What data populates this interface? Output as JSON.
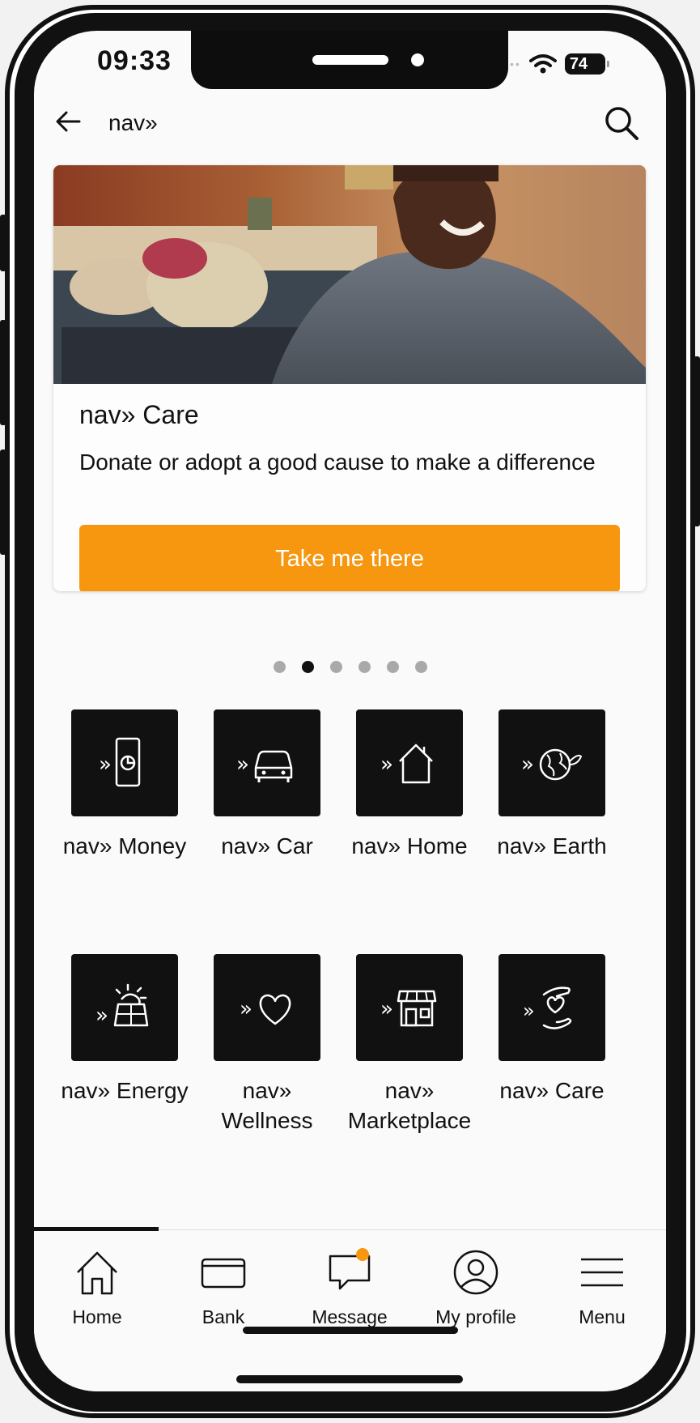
{
  "status_bar": {
    "time": "09:33",
    "battery": "74"
  },
  "header": {
    "title": "nav»"
  },
  "card": {
    "title": "nav» Care",
    "description": "Donate or adopt a good cause to make a difference",
    "button_label": "Take me there"
  },
  "pager": {
    "count": 6,
    "active_index": 1
  },
  "tiles": [
    {
      "label": "nav» Money",
      "icon": "money-phone-icon"
    },
    {
      "label": "nav» Car",
      "icon": "car-icon"
    },
    {
      "label": "nav» Home",
      "icon": "house-icon"
    },
    {
      "label": "nav» Earth",
      "icon": "globe-leaf-icon"
    },
    {
      "label": "nav» Energy",
      "icon": "solar-panel-icon"
    },
    {
      "label": "nav» Wellness",
      "icon": "heart-icon"
    },
    {
      "label": "nav» Marketplace",
      "icon": "storefront-icon"
    },
    {
      "label": "nav» Care",
      "icon": "hands-heart-icon"
    }
  ],
  "tabbar": {
    "items": [
      {
        "label": "Home",
        "icon": "home-icon"
      },
      {
        "label": "Bank",
        "icon": "card-icon"
      },
      {
        "label": "Message",
        "icon": "chat-icon"
      },
      {
        "label": "My profile",
        "icon": "profile-icon"
      },
      {
        "label": "Menu",
        "icon": "menu-icon"
      }
    ]
  },
  "colors": {
    "accent": "#f7960f",
    "tile_bg": "#111111"
  }
}
